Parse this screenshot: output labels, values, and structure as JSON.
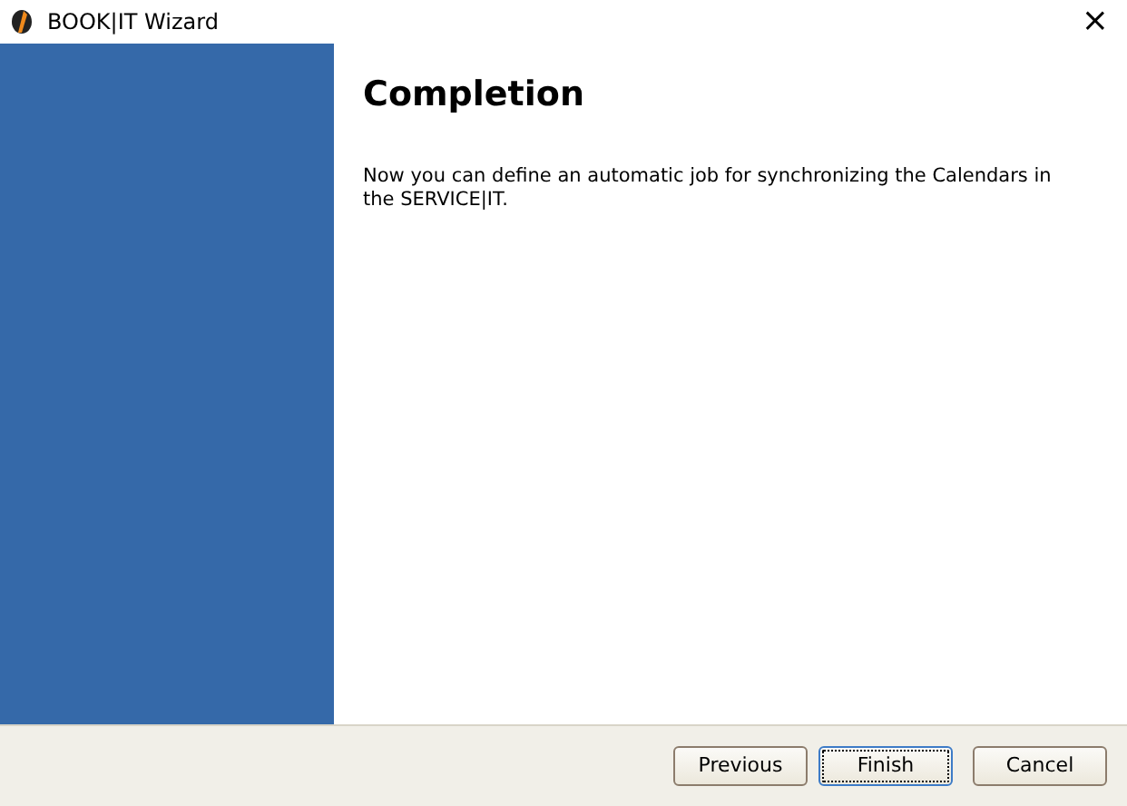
{
  "window": {
    "title": "BOOK|IT Wizard",
    "close": "×"
  },
  "page": {
    "heading": "Completion",
    "text": "Now you can define an automatic job for synchronizing the Calendars in the SERVICE|IT."
  },
  "buttons": [
    {
      "label": "Previous",
      "focused": false
    },
    {
      "label": "Finish",
      "focused": true
    },
    {
      "label": "Cancel",
      "focused": false
    }
  ]
}
